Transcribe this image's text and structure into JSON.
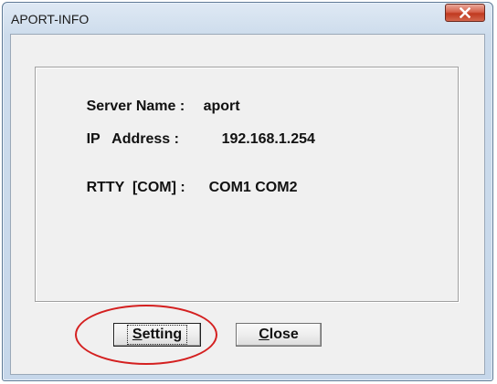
{
  "window": {
    "title": "APORT-INFO",
    "close_glyph": "✕"
  },
  "info": {
    "server_name": {
      "label": "Server Name :",
      "value": "aport"
    },
    "ip_address": {
      "label": "IP   Address :",
      "value": "192.168.1.254"
    },
    "rtty": {
      "label": "RTTY  [COM] :",
      "value": "COM1 COM2"
    }
  },
  "buttons": {
    "setting": {
      "mnemonic": "S",
      "rest": "etting"
    },
    "close": {
      "mnemonic": "C",
      "rest": "lose"
    }
  },
  "annotation": {
    "color": "#d42020"
  },
  "colors": {
    "close_button": "#c0391f",
    "frame": "#c6d7ea",
    "client": "#f0f0f0"
  }
}
